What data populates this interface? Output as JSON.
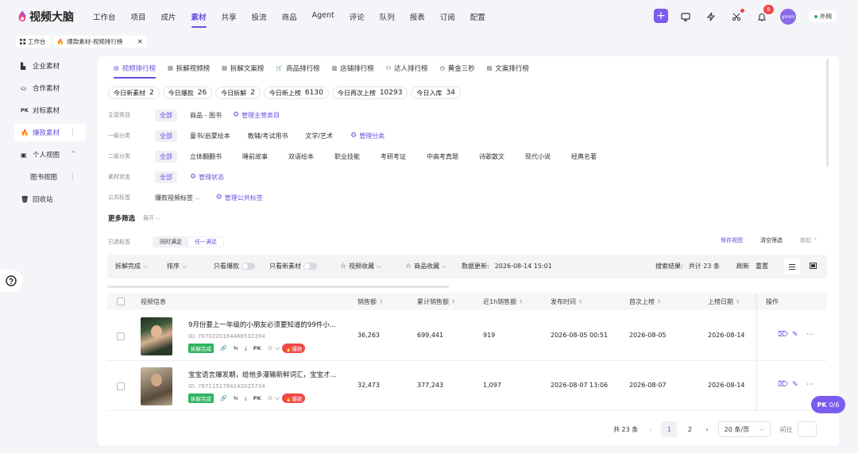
{
  "app": {
    "name": "视频大脑"
  },
  "nav": [
    "工作台",
    "项目",
    "成片",
    "素材",
    "共享",
    "投流",
    "商品",
    "Agent",
    "评论",
    "队列",
    "报表",
    "订阅",
    "配置"
  ],
  "nav_active": 3,
  "top": {
    "notif_count": "6",
    "user": "ymm",
    "network": "外网"
  },
  "tabs": {
    "workspace": "工作台",
    "current": "爆款素材-视频排行榜"
  },
  "sidebar": {
    "items": [
      "企业素材",
      "合作素材",
      "对标素材",
      "爆款素材",
      "个人视图",
      "图书视图",
      "回收站"
    ],
    "active": 3
  },
  "rank_tabs": [
    "视频排行榜",
    "拆解视频榜",
    "拆解文案榜",
    "商品排行榜",
    "店铺排行榜",
    "达人排行榜",
    "黄金三秒",
    "文案排行榜"
  ],
  "stats": [
    {
      "label": "今日新素材",
      "value": "2"
    },
    {
      "label": "今日爆款",
      "value": "26"
    },
    {
      "label": "今日拆解",
      "value": "2"
    },
    {
      "label": "今日新上榜",
      "value": "6130"
    },
    {
      "label": "今日再次上榜",
      "value": "10293"
    },
    {
      "label": "今日入库",
      "value": "34"
    }
  ],
  "filters": {
    "main_cat": {
      "label": "主营类目",
      "options": [
        "全部",
        "商品 - 图书"
      ],
      "manage": "管理主营类目"
    },
    "level1": {
      "label": "一级分类",
      "options": [
        "全部",
        "童书/启蒙绘本",
        "教辅/考试用书",
        "文学/艺术"
      ],
      "manage": "管理分类"
    },
    "level2": {
      "label": "二级分类",
      "options": [
        "全部",
        "立体翻翻书",
        "睡前故事",
        "双语绘本",
        "职业技能",
        "考研考证",
        "中高考真题",
        "诗歌散文",
        "现代小说",
        "经典名著"
      ]
    },
    "status": {
      "label": "素材状态",
      "options": [
        "全部"
      ],
      "manage": "管理状态"
    },
    "public_tag": {
      "label": "公共标签",
      "value": "爆款视频标签",
      "manage": "管理公共标签"
    },
    "more": "更多筛选",
    "expand": "展开",
    "selected_label": "已选标签",
    "match_all": "同时满足",
    "match_any": "任一满足",
    "save_view": "保存视图",
    "clear": "清空筛选",
    "collapse": "收起"
  },
  "toolbar": {
    "breakdown": "拆解完成",
    "sort": "排序",
    "only_hot": "只看爆款",
    "only_new": "只看新素材",
    "video_fav": "视频收藏",
    "goods_fav": "商品收藏",
    "update_label": "数据更新:",
    "update_time": "2026-08-14 15:01",
    "result_label": "搜索结果:",
    "result_count": "共计 23 条",
    "refresh": "刷新",
    "reset": "重置"
  },
  "table": {
    "headers": [
      "视频信息",
      "销售额",
      "累计销售额",
      "近1h销售额",
      "发布时间",
      "首次上榜",
      "上榜日期",
      "操作"
    ],
    "rows": [
      {
        "title": "9月份要上一年级的小朋友必须要知道的99件小...",
        "id": "ID: 7670220164486532394",
        "tag": "拆解完成",
        "hot": "爆款",
        "sales": "36,263",
        "total": "699,441",
        "h1": "919",
        "publish": "2026-08-05 00:51",
        "first": "2026-08-05",
        "date": "2026-08-14"
      },
      {
        "title": "宝宝语言爆发期，给他多灌输新鲜词汇，宝宝才...",
        "id": "ID: 7671151784242025734",
        "tag": "拆解完成",
        "hot": "爆款",
        "sales": "32,473",
        "total": "377,243",
        "h1": "1,097",
        "publish": "2026-08-07 13:06",
        "first": "2026-08-07",
        "date": "2026-08-14"
      }
    ]
  },
  "pager": {
    "total": "共 23 条",
    "pages": [
      "1",
      "2"
    ],
    "size": "20 条/页",
    "goto": "前往"
  },
  "pk": {
    "label": "PK",
    "value": "0/6"
  },
  "colors": {
    "accent": "#6b4fe0",
    "green": "#2fb35e",
    "red": "#f04848"
  }
}
